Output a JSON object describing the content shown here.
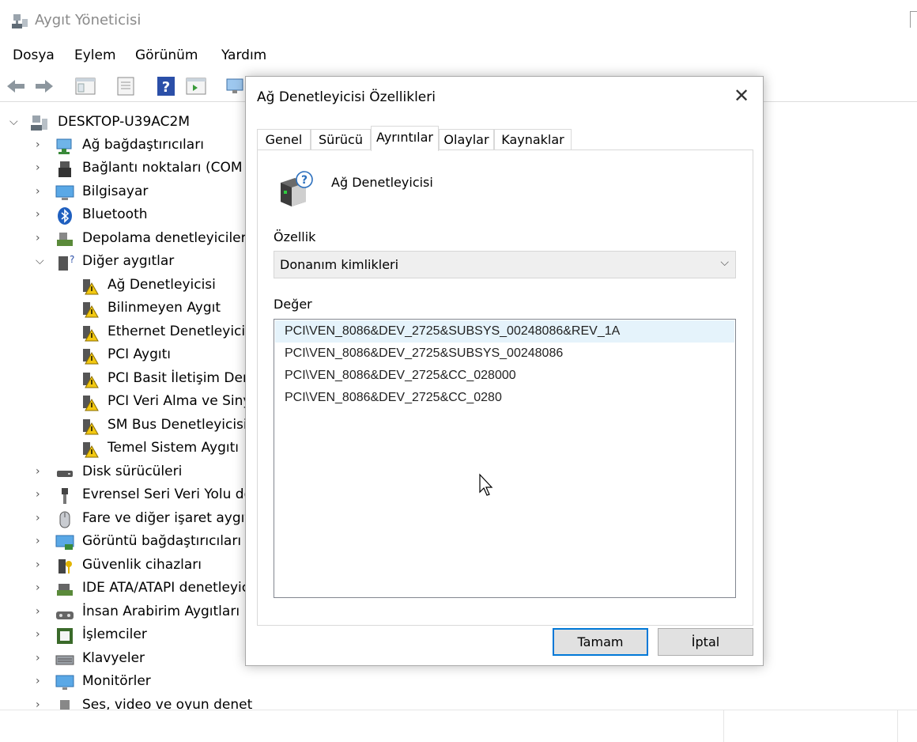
{
  "window": {
    "title": "Aygıt Yöneticisi"
  },
  "menu": [
    "Dosya",
    "Eylem",
    "Görünüm",
    "Yardım"
  ],
  "tree": {
    "root": "DESKTOP-U39AC2M",
    "items": [
      {
        "label": "Ağ bağdaştırıcıları",
        "icon": "network-adapter-icon"
      },
      {
        "label": "Bağlantı noktaları (COM",
        "icon": "port-icon"
      },
      {
        "label": "Bilgisayar",
        "icon": "computer-icon"
      },
      {
        "label": "Bluetooth",
        "icon": "bluetooth-icon"
      },
      {
        "label": "Depolama denetleyiciler",
        "icon": "storage-controller-icon"
      },
      {
        "label": "Diğer aygıtlar",
        "icon": "other-devices-icon"
      },
      {
        "label": "Ağ Denetleyicisi",
        "icon": "warning-device-icon"
      },
      {
        "label": "Bilinmeyen Aygıt",
        "icon": "warning-device-icon"
      },
      {
        "label": "Ethernet Denetleyicis",
        "icon": "warning-device-icon"
      },
      {
        "label": "PCI Aygıtı",
        "icon": "warning-device-icon"
      },
      {
        "label": "PCI Basit İletişim Den",
        "icon": "warning-device-icon"
      },
      {
        "label": "PCI Veri Alma ve Siny",
        "icon": "warning-device-icon"
      },
      {
        "label": "SM Bus Denetleyicisi",
        "icon": "warning-device-icon"
      },
      {
        "label": "Temel Sistem Aygıtı",
        "icon": "warning-device-icon"
      },
      {
        "label": "Disk sürücüleri",
        "icon": "disk-drive-icon"
      },
      {
        "label": "Evrensel Seri Veri Yolu de",
        "icon": "usb-icon"
      },
      {
        "label": "Fare ve diğer işaret aygıt",
        "icon": "mouse-icon"
      },
      {
        "label": "Görüntü bağdaştırıcıları",
        "icon": "display-adapter-icon"
      },
      {
        "label": "Güvenlik cihazları",
        "icon": "security-device-icon"
      },
      {
        "label": "IDE ATA/ATAPI denetleyic",
        "icon": "ide-controller-icon"
      },
      {
        "label": "İnsan Arabirim Aygıtları",
        "icon": "hid-icon"
      },
      {
        "label": "İşlemciler",
        "icon": "processor-icon"
      },
      {
        "label": "Klavyeler",
        "icon": "keyboard-icon"
      },
      {
        "label": "Monitörler",
        "icon": "monitor-icon"
      },
      {
        "label": "Ses, video ve oyun denetleyicileri",
        "icon": "audio-icon"
      }
    ]
  },
  "dialog": {
    "title": "Ağ Denetleyicisi Özellikleri",
    "close_glyph": "✕",
    "tabs": [
      "Genel",
      "Sürücü",
      "Ayrıntılar",
      "Olaylar",
      "Kaynaklar"
    ],
    "active_tab": "Ayrıntılar",
    "device_name": "Ağ Denetleyicisi",
    "property_label": "Özellik",
    "property_value": "Donanım kimlikleri",
    "value_label": "Değer",
    "values": [
      "PCI\\VEN_8086&DEV_2725&SUBSYS_00248086&REV_1A",
      "PCI\\VEN_8086&DEV_2725&SUBSYS_00248086",
      "PCI\\VEN_8086&DEV_2725&CC_028000",
      "PCI\\VEN_8086&DEV_2725&CC_0280"
    ],
    "ok_label": "Tamam",
    "cancel_label": "İptal"
  },
  "colors": {
    "selection": "#e5f3fb",
    "accent": "#0078d7",
    "warning": "#f2c811"
  }
}
